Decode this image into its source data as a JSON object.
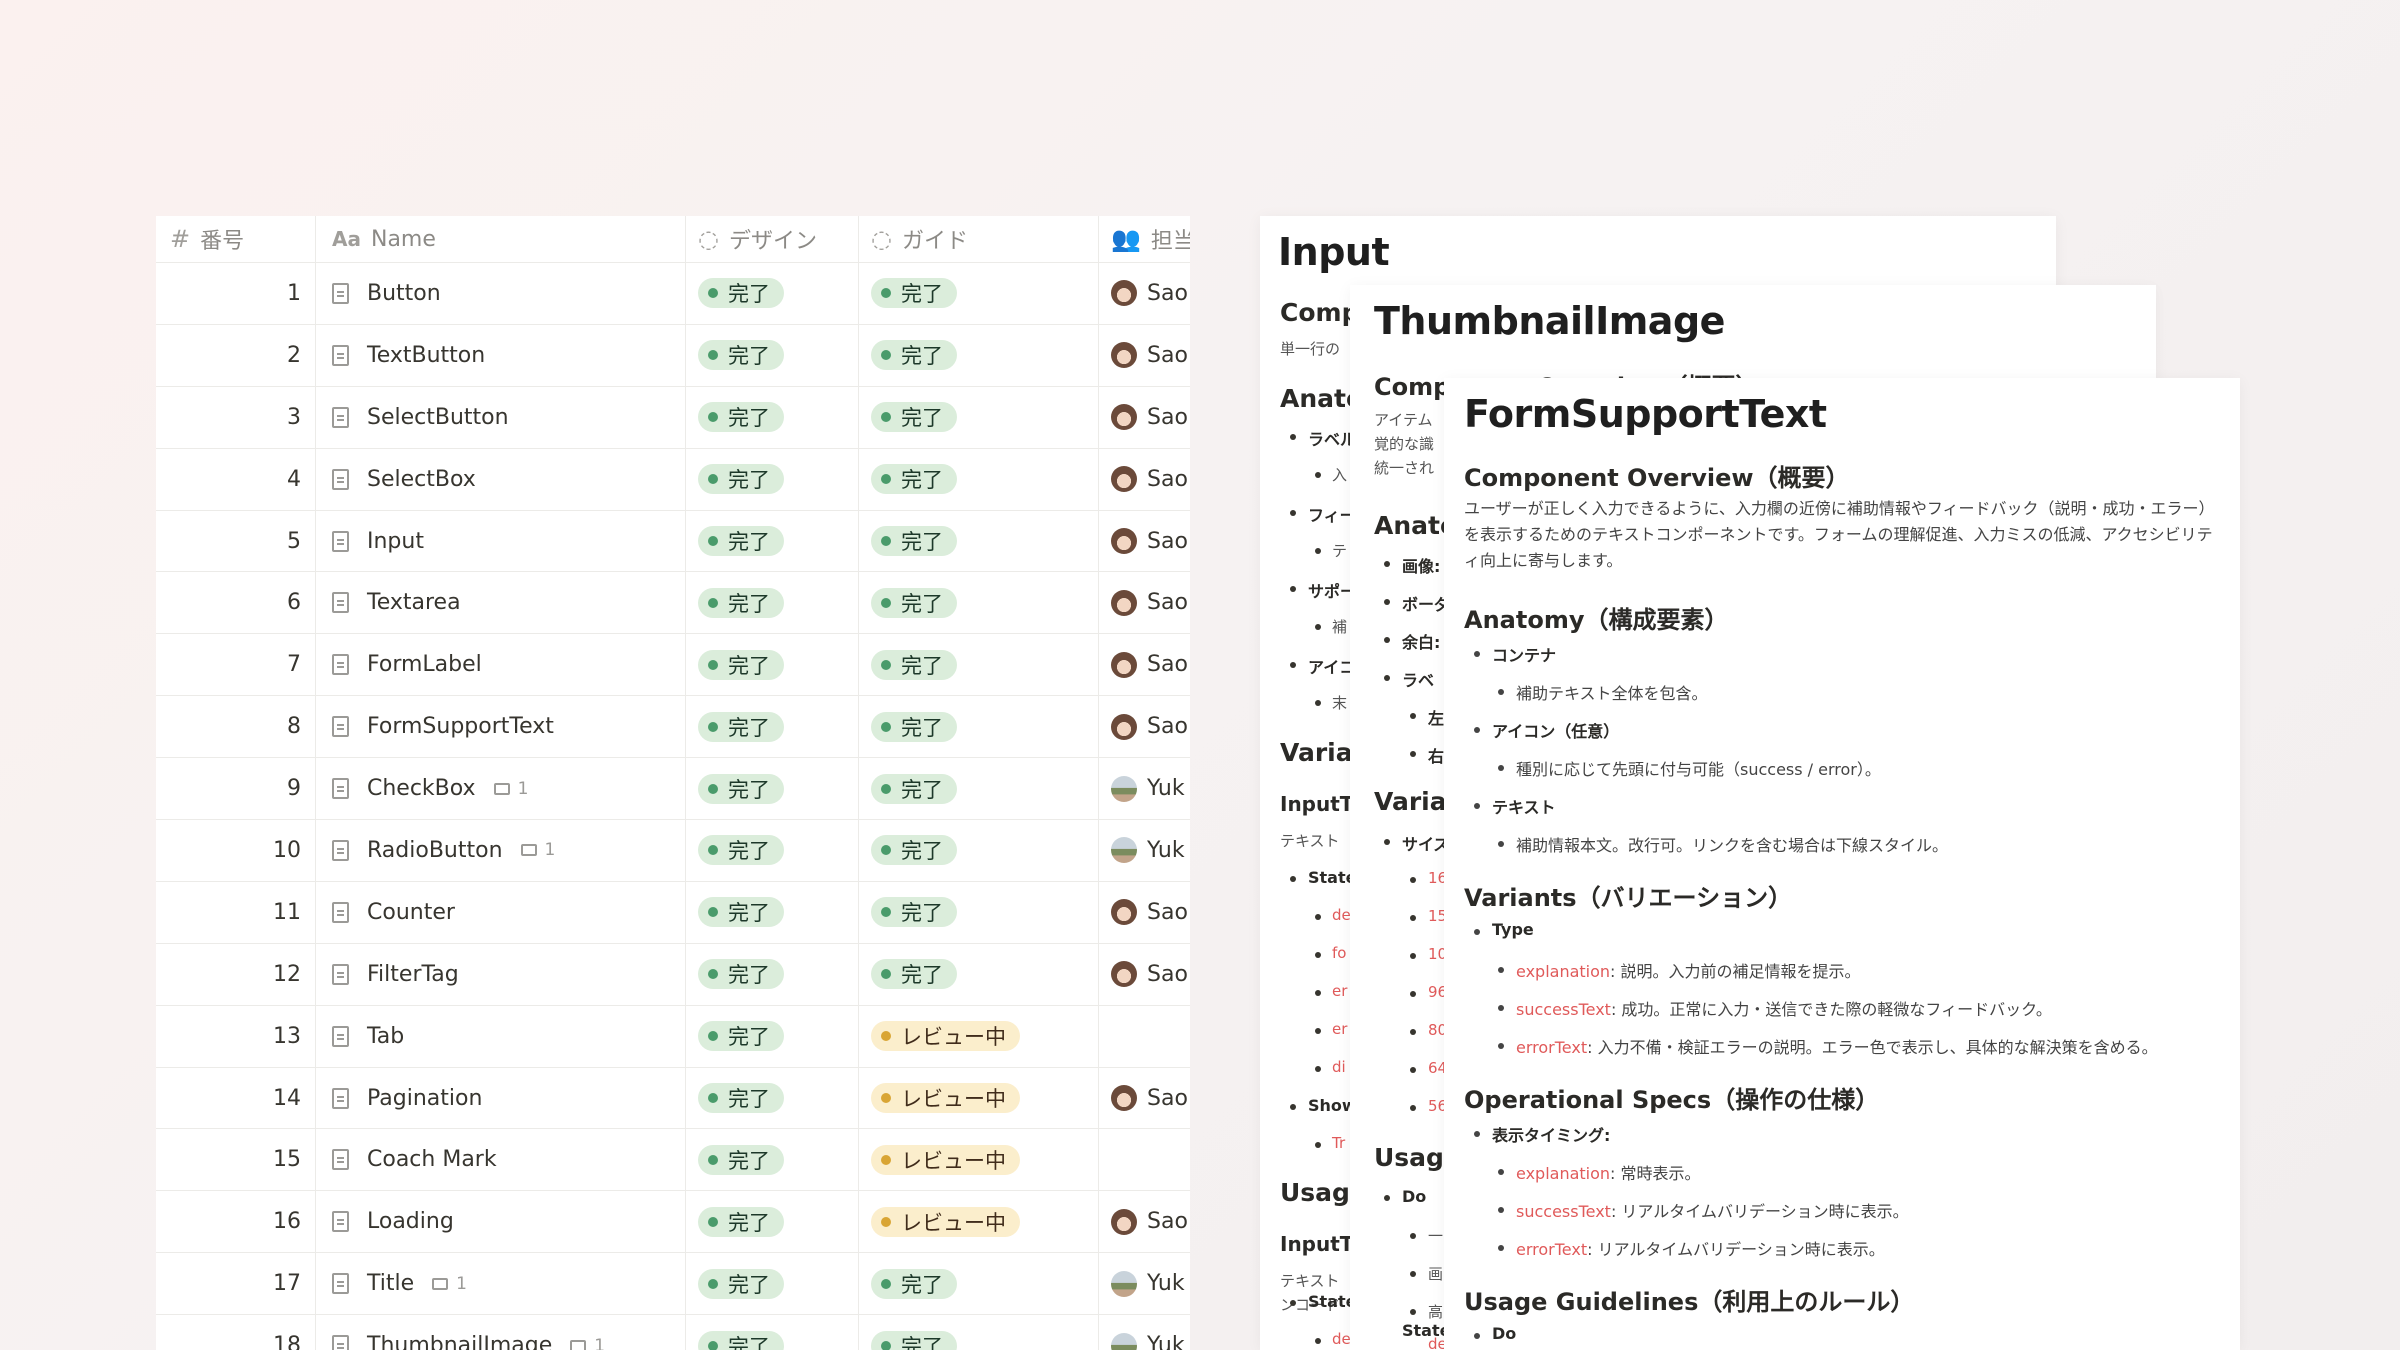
{
  "table": {
    "headers": {
      "number": "番号",
      "name": "Name",
      "design": "デザイン",
      "guide": "ガイド",
      "owner": "担当"
    },
    "rows": [
      {
        "num": "1",
        "name": "Button",
        "comments": "",
        "design": "完了",
        "guide": "完了",
        "guide_status": "done",
        "owner": "Sao",
        "avatar": "s"
      },
      {
        "num": "2",
        "name": "TextButton",
        "comments": "",
        "design": "完了",
        "guide": "完了",
        "guide_status": "done",
        "owner": "Sao",
        "avatar": "s"
      },
      {
        "num": "3",
        "name": "SelectButton",
        "comments": "",
        "design": "完了",
        "guide": "完了",
        "guide_status": "done",
        "owner": "Sao",
        "avatar": "s"
      },
      {
        "num": "4",
        "name": "SelectBox",
        "comments": "",
        "design": "完了",
        "guide": "完了",
        "guide_status": "done",
        "owner": "Sao",
        "avatar": "s"
      },
      {
        "num": "5",
        "name": "Input",
        "comments": "",
        "design": "完了",
        "guide": "完了",
        "guide_status": "done",
        "owner": "Sao",
        "avatar": "s"
      },
      {
        "num": "6",
        "name": "Textarea",
        "comments": "",
        "design": "完了",
        "guide": "完了",
        "guide_status": "done",
        "owner": "Sao",
        "avatar": "s"
      },
      {
        "num": "7",
        "name": "FormLabel",
        "comments": "",
        "design": "完了",
        "guide": "完了",
        "guide_status": "done",
        "owner": "Sao",
        "avatar": "s"
      },
      {
        "num": "8",
        "name": "FormSupportText",
        "comments": "",
        "design": "完了",
        "guide": "完了",
        "guide_status": "done",
        "owner": "Sao",
        "avatar": "s"
      },
      {
        "num": "9",
        "name": "CheckBox",
        "comments": "1",
        "design": "完了",
        "guide": "完了",
        "guide_status": "done",
        "owner": "Yuk",
        "avatar": "y"
      },
      {
        "num": "10",
        "name": "RadioButton",
        "comments": "1",
        "design": "完了",
        "guide": "完了",
        "guide_status": "done",
        "owner": "Yuk",
        "avatar": "y"
      },
      {
        "num": "11",
        "name": "Counter",
        "comments": "",
        "design": "完了",
        "guide": "完了",
        "guide_status": "done",
        "owner": "Sao",
        "avatar": "s"
      },
      {
        "num": "12",
        "name": "FilterTag",
        "comments": "",
        "design": "完了",
        "guide": "完了",
        "guide_status": "done",
        "owner": "Sao",
        "avatar": "s"
      },
      {
        "num": "13",
        "name": "Tab",
        "comments": "",
        "design": "完了",
        "guide": "レビュー中",
        "guide_status": "review",
        "owner": "",
        "avatar": ""
      },
      {
        "num": "14",
        "name": "Pagination",
        "comments": "",
        "design": "完了",
        "guide": "レビュー中",
        "guide_status": "review",
        "owner": "Sao",
        "avatar": "s"
      },
      {
        "num": "15",
        "name": "Coach Mark",
        "comments": "",
        "design": "完了",
        "guide": "レビュー中",
        "guide_status": "review",
        "owner": "",
        "avatar": ""
      },
      {
        "num": "16",
        "name": "Loading",
        "comments": "",
        "design": "完了",
        "guide": "レビュー中",
        "guide_status": "review",
        "owner": "Sao",
        "avatar": "s"
      },
      {
        "num": "17",
        "name": "Title",
        "comments": "1",
        "design": "完了",
        "guide": "完了",
        "guide_status": "done",
        "owner": "Yuk",
        "avatar": "y"
      },
      {
        "num": "18",
        "name": "ThumbnailImage",
        "comments": "1",
        "design": "完了",
        "guide": "完了",
        "guide_status": "done",
        "owner": "Yuk",
        "avatar": "y"
      }
    ]
  },
  "doc_input": {
    "title": "Input",
    "fragments": {
      "comp": "Comp",
      "desc": "単一行の",
      "anato": "Anato",
      "label": "ラベル",
      "in1": "入",
      "field": "フィー",
      "te": "テ",
      "support": "サポー",
      "ho": "補",
      "icon": "アイコ",
      "sue": "末",
      "varian": "Varian",
      "inputte": "InputTe",
      "textto": "テキスト",
      "state": "State",
      "de": "de",
      "fo": "fo",
      "er1": "er",
      "er2": "er",
      "di": "di",
      "show": "Show",
      "tr": "Tr",
      "usage": "Usage",
      "inputte2": "InputTe",
      "textto2": "テキスト",
      "encode": "ンコード",
      "state2": "State",
      "de2": "de"
    }
  },
  "doc_thumb": {
    "title": "ThumbnailImage",
    "fragments": {
      "overview": "Component Overview（概要）",
      "item": "アイテム",
      "kaku": "覚的な識",
      "tou": "統一され",
      "anato": "Anato",
      "gazo": "画像:",
      "boda": "ボーダ",
      "yohaku": "余白:",
      "rabe": "ラベ",
      "hidari": "左",
      "migi": "右",
      "varian": "Varian",
      "size": "サイズ",
      "s16": "16",
      "s15": "15",
      "s10": "10",
      "s96": "96",
      "s80": "80",
      "s64": "64",
      "s56": "56",
      "usage": "Usage",
      "do": "Do",
      "dash": "一",
      "ga": "画",
      "ko": "高",
      "state": "State",
      "de": "de"
    }
  },
  "doc_form": {
    "title": "FormSupportText",
    "overview_h": "Component Overview（概要）",
    "overview_p": "ユーザーが正しく入力できるように、入力欄の近傍に補助情報やフィードバック（説明・成功・エラー）を表示するためのテキストコンポーネントです。フォームの理解促進、入力ミスの低減、アクセシビリティ向上に寄与します。",
    "anatomy_h": "Anatomy（構成要素）",
    "container": "コンテナ",
    "container_desc": "補助テキスト全体を包含。",
    "icon": "アイコン（任意）",
    "icon_desc": "種別に応じて先頭に付与可能（success / error）。",
    "text": "テキスト",
    "text_desc": "補助情報本文。改行可。リンクを含む場合は下線スタイル。",
    "variants_h": "Variants（バリエーション）",
    "type": "Type",
    "v1_key": "explanation",
    "v1_desc": ": 説明。入力前の補足情報を提示。",
    "v2_key": "successText",
    "v2_desc": ": 成功。正常に入力・送信できた際の軽微なフィードバック。",
    "v3_key": "errorText",
    "v3_desc": ": 入力不備・検証エラーの説明。エラー色で表示し、具体的な解決策を含める。",
    "ops_h": "Operational Specs（操作の仕様）",
    "timing": "表示タイミング:",
    "o1_key": "explanation",
    "o1_desc": ": 常時表示。",
    "o2_key": "successText",
    "o2_desc": ": リアルタイムバリデーション時に表示。",
    "o3_key": "errorText",
    "o3_desc": ": リアルタイムバリデーション時に表示。",
    "usage_h": "Usage Guidelines（利用上のルール）",
    "do": "Do"
  }
}
